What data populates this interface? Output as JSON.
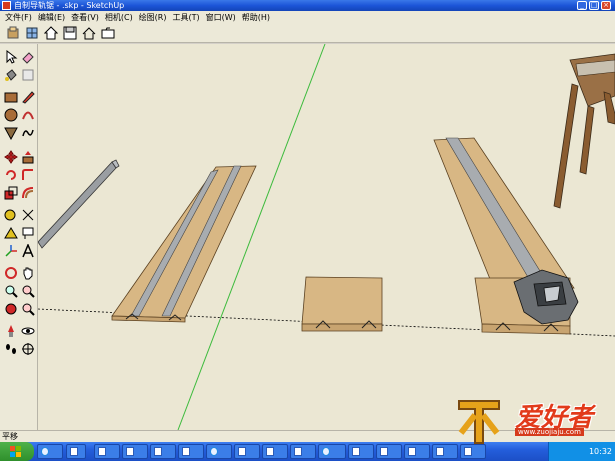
{
  "window": {
    "title": "自制导轨锯 - .skp - SketchUp"
  },
  "menubar": {
    "items": [
      "文件(F)",
      "编辑(E)",
      "查看(V)",
      "相机(C)",
      "绘图(R)",
      "工具(T)",
      "窗口(W)",
      "帮助(H)"
    ]
  },
  "toptoolbar": {
    "buttons": [
      "getting-started-icon",
      "components-icon",
      "home-icon",
      "save-icon",
      "house-icon",
      "open-folder-icon"
    ]
  },
  "lefttoolbar": {
    "tools": [
      "select-icon",
      "eraser-icon",
      "paint-bucket-icon",
      "rectangle-icon",
      "pencil-icon",
      "circle-icon",
      "arc-icon",
      "polygon-icon",
      "freehand-icon",
      "move-icon",
      "push-pull-icon",
      "rotate-icon",
      "follow-me-icon",
      "scale-icon",
      "offset-icon",
      "tape-measure-icon",
      "dimension-icon",
      "protractor-icon",
      "text-icon",
      "axes-icon",
      "3d-text-icon",
      "orbit-icon",
      "pan-icon",
      "zoom-icon",
      "zoom-window-icon",
      "zoom-extents-icon",
      "previous-view-icon",
      "position-camera-icon",
      "look-around-icon",
      "walk-icon",
      "section-plane-icon"
    ]
  },
  "statusbar": {
    "text": "平移"
  },
  "taskbar": {
    "tasks": [
      "",
      "",
      "",
      "",
      "",
      "",
      "",
      "",
      "",
      "",
      "",
      "",
      "",
      "",
      "",
      ""
    ],
    "clock": "10:32"
  },
  "watermark": {
    "brand": "爱好者",
    "url": "www.zuojiaju.com",
    "logo": "木"
  },
  "colors": {
    "viewport_bg": "#ebe7d3",
    "wood": "#d8b784",
    "rail": "#a8acb0",
    "green_axis": "#3dbb3d",
    "red_axis": "#c83a3a"
  }
}
